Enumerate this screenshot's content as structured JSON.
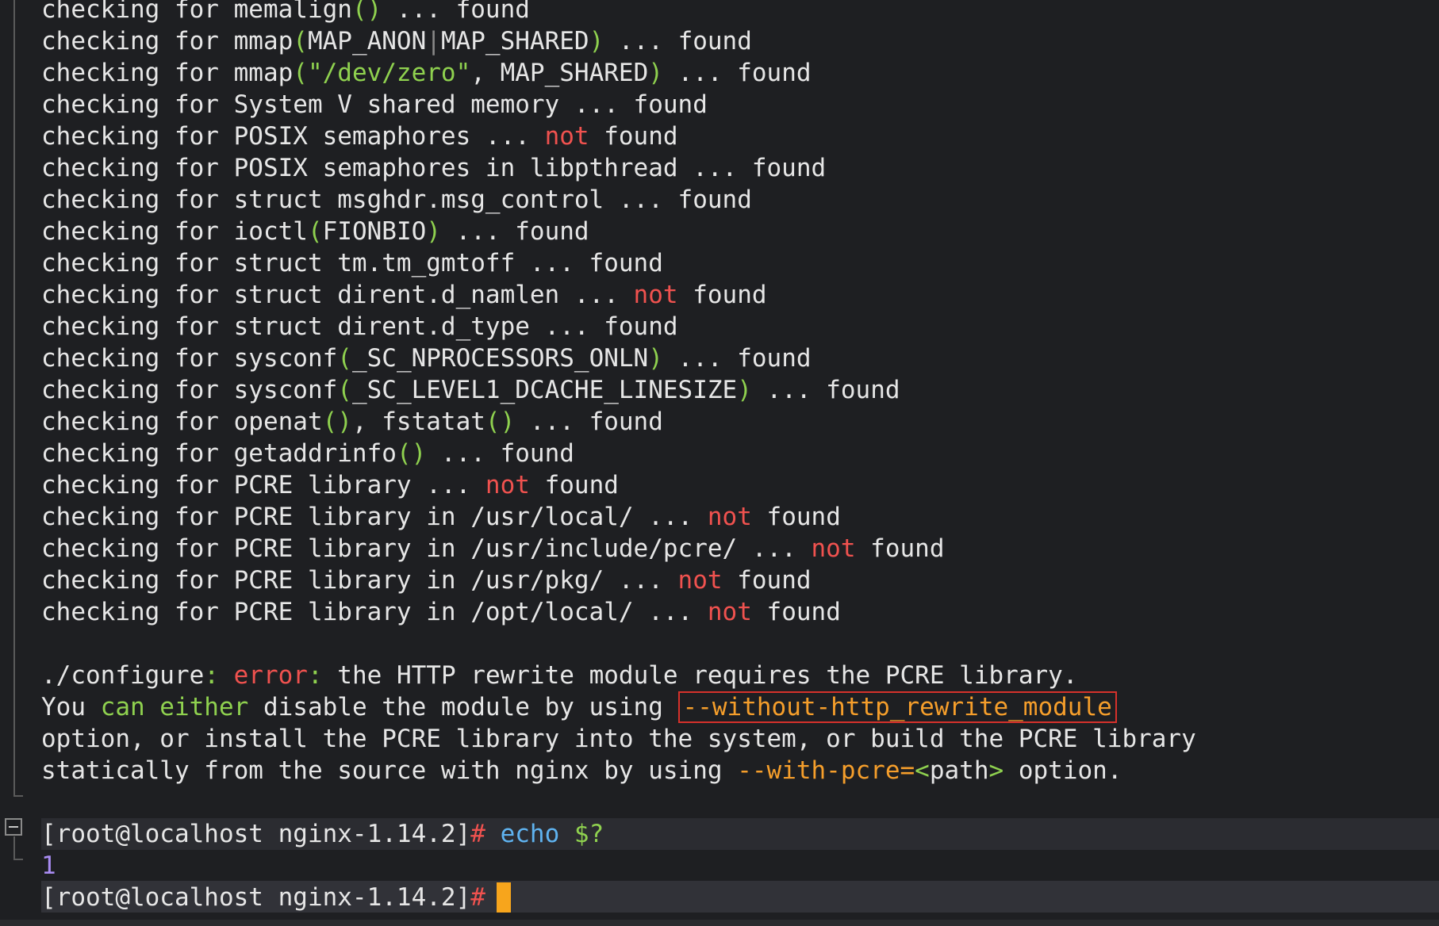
{
  "lines": [
    {
      "pre": "checking for memalign",
      "p1": "()",
      "post": " ... found",
      "type": "paren"
    },
    {
      "pre": "checking for mmap",
      "p1": "(",
      "mid": "MAP_ANON",
      "sep": "|",
      "mid2": "MAP_SHARED",
      "p2": ")",
      "post": " ... found",
      "type": "mmap1"
    },
    {
      "pre": "checking for mmap",
      "p1": "(",
      "str": "\"/dev/zero\"",
      "mid": ", MAP_SHARED",
      "p2": ")",
      "post": " ... found",
      "type": "mmap2"
    },
    {
      "text": "checking for System V shared memory ... found",
      "type": "plain"
    },
    {
      "pre": "checking for POSIX semaphores ... ",
      "not": "not",
      "post": " found",
      "type": "notfound"
    },
    {
      "text": "checking for POSIX semaphores in libpthread ... found",
      "type": "plain"
    },
    {
      "text": "checking for struct msghdr.msg_control ... found",
      "type": "plain"
    },
    {
      "pre": "checking for ioctl",
      "p1": "(",
      "mid": "FIONBIO",
      "p2": ")",
      "post": " ... found",
      "type": "call"
    },
    {
      "text": "checking for struct tm.tm_gmtoff ... found",
      "type": "plain"
    },
    {
      "pre": "checking for struct dirent.d_namlen ... ",
      "not": "not",
      "post": " found",
      "type": "notfound"
    },
    {
      "text": "checking for struct dirent.d_type ... found",
      "type": "plain"
    },
    {
      "pre": "checking for sysconf",
      "p1": "(",
      "mid": "_SC_NPROCESSORS_ONLN",
      "p2": ")",
      "post": " ... found",
      "type": "call"
    },
    {
      "pre": "checking for sysconf",
      "p1": "(",
      "mid": "_SC_LEVEL1_DCACHE_LINESIZE",
      "p2": ")",
      "post": " ... found",
      "type": "call"
    },
    {
      "pre": "checking for openat",
      "p1": "()",
      "mid": ", fstatat",
      "p2": "()",
      "post": " ... found",
      "type": "openat"
    },
    {
      "pre": "checking for getaddrinfo",
      "p1": "()",
      "post": " ... found",
      "type": "paren"
    },
    {
      "pre": "checking for PCRE library ... ",
      "not": "not",
      "post": " found",
      "type": "notfound"
    },
    {
      "pre": "checking for PCRE library in /usr/local/ ... ",
      "not": "not",
      "post": " found",
      "type": "notfound"
    },
    {
      "pre": "checking for PCRE library in /usr/include/pcre/ ... ",
      "not": "not",
      "post": " found",
      "type": "notfound"
    },
    {
      "pre": "checking for PCRE library in /usr/pkg/ ... ",
      "not": "not",
      "post": " found",
      "type": "notfound"
    },
    {
      "pre": "checking for PCRE library in /opt/local/ ... ",
      "not": "not",
      "post": " found",
      "type": "notfound"
    }
  ],
  "error": {
    "line1_a": "./configure",
    "line1_colon": ":",
    "line1_error": " error",
    "line1_colon2": ":",
    "line1_rest": " the HTTP rewrite module requires the PCRE library.",
    "line2_you": "You ",
    "line2_can": "can either",
    "line2_rest": " disable the module by using ",
    "line2_opt": "--without-http_rewrite_module",
    "line3": "option, or install the PCRE library into the system, or build the PCRE library",
    "line4_a": "statically from the source with nginx by using ",
    "line4_opt": "--with-pcre=",
    "line4_lt": "<",
    "line4_path": "path",
    "line4_gt": ">",
    "line4_rest": " option."
  },
  "prompt1": {
    "prompt": "[root@localhost nginx-1.14.2]",
    "hash": "#",
    "cmd": " echo",
    "arg": " $?"
  },
  "output": "1",
  "prompt2": {
    "prompt": "[root@localhost nginx-1.14.2]",
    "hash": "#"
  }
}
